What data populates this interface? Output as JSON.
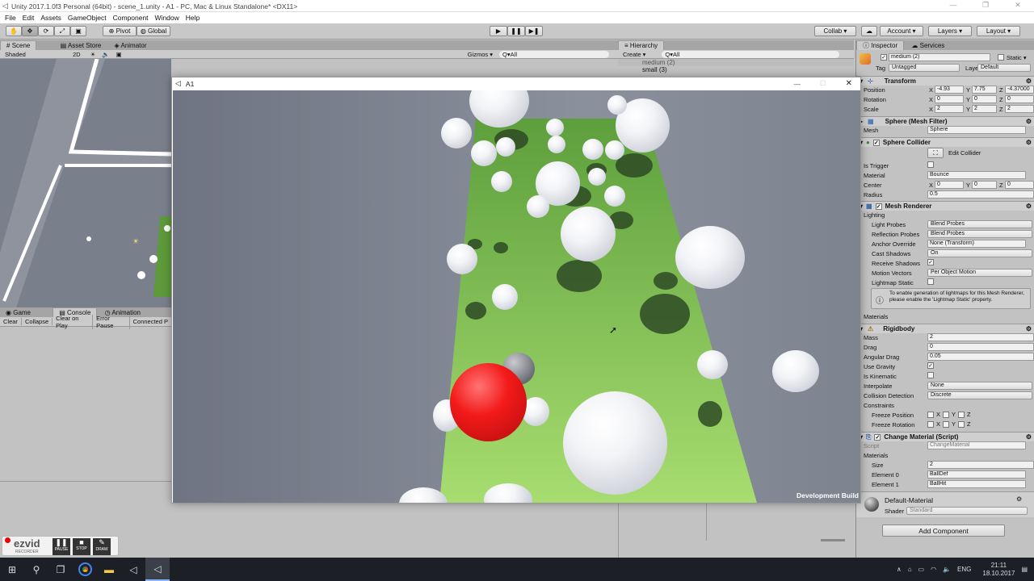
{
  "window": {
    "title": "Unity 2017.1.0f3 Personal (64bit) - scene_1.unity - A1 - PC, Mac & Linux Standalone* <DX11>"
  },
  "menu": [
    "File",
    "Edit",
    "Assets",
    "GameObject",
    "Component",
    "Window",
    "Help"
  ],
  "toolbar": {
    "pivot": "Pivot",
    "global": "Global",
    "collab": "Collab ▾",
    "account": "Account",
    "layers": "Layers",
    "layout": "Layout"
  },
  "scene_tabs": {
    "scene": "Scene",
    "asset_store": "Asset Store",
    "animator": "Animator",
    "shaded": "Shaded",
    "mode2d": "2D",
    "gizmos": "Gizmos ▾",
    "search": "Q▾All"
  },
  "bottom_tabs": {
    "game": "Game",
    "console": "Console",
    "animation": "Animation"
  },
  "console_buttons": [
    "Clear",
    "Collapse",
    "Clear on Play",
    "Error Pause",
    "Connected P"
  ],
  "hierarchy": {
    "tab": "Hierarchy",
    "create": "Create ▾",
    "search": "Q▾All",
    "items": [
      "medium (2)",
      "small (3)"
    ]
  },
  "game_window": {
    "title": "A1",
    "watermark": "Development Build"
  },
  "inspector": {
    "tabs": [
      "Inspector",
      "Services"
    ],
    "object_name": "medium (2)",
    "static": "Static ▾",
    "tag_label": "Tag",
    "tag": "Untagged",
    "layer_label": "Layer",
    "layer": "Default",
    "transform": {
      "title": "Transform",
      "position_label": "Position",
      "position": [
        "-4.93",
        "7.75",
        "-4.37000"
      ],
      "rotation_label": "Rotation",
      "rotation": [
        "0",
        "0",
        "0"
      ],
      "scale_label": "Scale",
      "scale": [
        "2",
        "2",
        "2"
      ]
    },
    "mesh_filter": {
      "title": "Sphere (Mesh Filter)",
      "mesh_label": "Mesh",
      "mesh": "Sphere"
    },
    "collider": {
      "title": "Sphere Collider",
      "edit": "Edit Collider",
      "is_trigger": "Is Trigger",
      "material_label": "Material",
      "material": "Bounce",
      "center_label": "Center",
      "center": [
        "0",
        "0",
        "0"
      ],
      "radius_label": "Radius",
      "radius": "0.5"
    },
    "renderer": {
      "title": "Mesh Renderer",
      "lighting": "Lighting",
      "light_probes_label": "Light Probes",
      "light_probes": "Blend Probes",
      "reflection_label": "Reflection Probes",
      "reflection": "Blend Probes",
      "anchor_label": "Anchor Override",
      "anchor": "None (Transform)",
      "cast_label": "Cast Shadows",
      "cast": "On",
      "receive_label": "Receive Shadows",
      "motion_label": "Motion Vectors",
      "motion": "Per Object Motion",
      "lightmap_label": "Lightmap Static",
      "info": "To enable generation of lightmaps for this Mesh Renderer, please enable the 'Lightmap Static' property.",
      "materials": "Materials"
    },
    "rigidbody": {
      "title": "Rigidbody",
      "mass_label": "Mass",
      "mass": "2",
      "drag_label": "Drag",
      "drag": "0",
      "angular_label": "Angular Drag",
      "angular": "0.05",
      "gravity_label": "Use Gravity",
      "kinematic_label": "Is Kinematic",
      "interpolate_label": "Interpolate",
      "interpolate": "None",
      "collision_label": "Collision Detection",
      "collision": "Discrete",
      "constraints": "Constraints",
      "freeze_pos": "Freeze Position",
      "freeze_rot": "Freeze Rotation",
      "x": "X",
      "y": "Y",
      "z": "Z"
    },
    "script": {
      "title": "Change Material (Script)",
      "script_label": "Script",
      "script": "ChangeMaterial",
      "materials": "Materials",
      "size_label": "Size",
      "size": "2",
      "el0_label": "Element 0",
      "el0": "BallDef",
      "el1_label": "Element 1",
      "el1": "BallHit"
    },
    "material": {
      "name": "Default-Material",
      "shader_label": "Shader",
      "shader": "Standard"
    },
    "add_component": "Add Component"
  },
  "recorder": {
    "logo": "ezvid",
    "sub": "RECORDER",
    "pause": "PAUSE",
    "stop": "STOP",
    "draw": "DRAW"
  },
  "taskbar": {
    "lang": "ENG",
    "time": "21:11",
    "date": "18.10.2017"
  }
}
